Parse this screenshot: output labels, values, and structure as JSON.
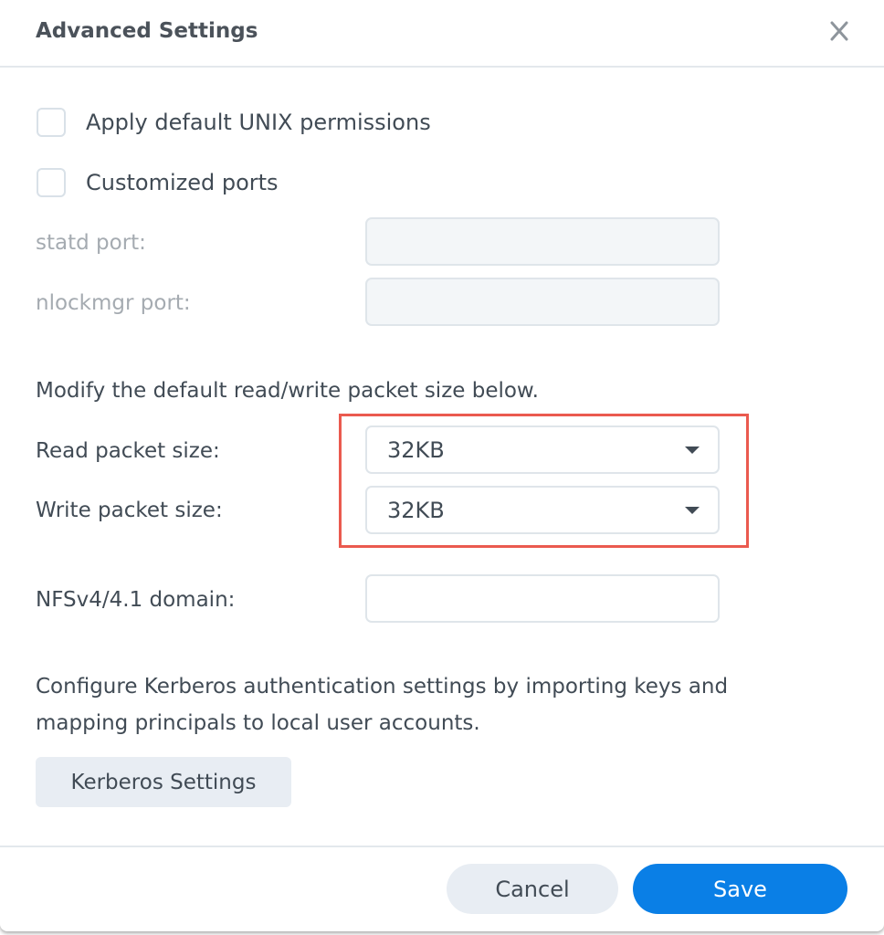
{
  "dialog": {
    "title": "Advanced Settings",
    "close_icon": "close-icon"
  },
  "options": {
    "unix_permissions": {
      "label": "Apply default UNIX permissions",
      "checked": false
    },
    "customized_ports": {
      "label": "Customized ports",
      "checked": false
    }
  },
  "ports": {
    "statd_label": "statd port:",
    "statd_value": "",
    "nlockmgr_label": "nlockmgr port:",
    "nlockmgr_value": ""
  },
  "packet": {
    "description": "Modify the default read/write packet size below.",
    "read_label": "Read packet size:",
    "read_value": "32KB",
    "write_label": "Write packet size:",
    "write_value": "32KB"
  },
  "nfs": {
    "domain_label": "NFSv4/4.1 domain:",
    "domain_value": ""
  },
  "kerberos": {
    "description_line1": "Configure Kerberos authentication settings by importing keys and",
    "description_line2": "mapping principals to local user accounts.",
    "button_label": "Kerberos Settings"
  },
  "footer": {
    "cancel_label": "Cancel",
    "save_label": "Save"
  },
  "colors": {
    "primary": "#0a7fe6",
    "highlight": "#ea5a4f"
  }
}
